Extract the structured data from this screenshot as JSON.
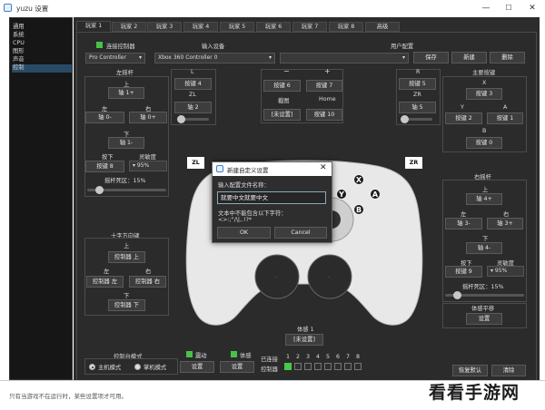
{
  "window": {
    "title": "yuzu 设置",
    "minimize": "—",
    "maximize": "☐",
    "close": "✕"
  },
  "sidebar": {
    "items": [
      "通用",
      "系统",
      "CPU",
      "图形",
      "声音",
      "控制"
    ],
    "selected": 5
  },
  "tabs": [
    "玩家 1",
    "玩家 2",
    "玩家 3",
    "玩家 4",
    "玩家 5",
    "玩家 6",
    "玩家 7",
    "玩家 8",
    "高级"
  ],
  "header": {
    "connect_label": "连接控制器",
    "controller_type": "Pro Controller",
    "input_device_label": "输入设备",
    "input_device": "Xbox 360 Controller 0",
    "user_profile_label": "用户配置",
    "save": "保存",
    "new": "新建",
    "delete": "删除"
  },
  "left_stick": {
    "title": "左摇杆",
    "up": "上",
    "up_btn": "轴 1+",
    "left": "左",
    "left_btn": "轴 0-",
    "right": "右",
    "right_btn": "轴 0+",
    "down": "下",
    "down_btn": "轴 1-",
    "press": "按下",
    "press_btn": "按键 8",
    "sensitivity": "灵敏度",
    "sensitivity_val": "95%",
    "deadzone": "摇杆死区：15%",
    "deadzone_fraction": 0.15
  },
  "dpad": {
    "title": "十字方向键",
    "up": "上",
    "up_btn": "控制器 上",
    "left": "左",
    "left_btn": "控制器 左",
    "right": "右",
    "right_btn": "控制器 右",
    "down": "下",
    "down_btn": "控制器 下"
  },
  "shoulders": {
    "L": "L",
    "L_btn": "按键 4",
    "ZL": "ZL",
    "ZL_btn": "轴 2",
    "minus": "−",
    "minus_btn": "按键 6",
    "plus": "+",
    "plus_btn": "按键 7",
    "capture": "截图",
    "capture_btn": "[未设置]",
    "home": "Home",
    "home_btn": "按键 10",
    "R": "R",
    "R_btn": "按键 5",
    "ZR": "ZR",
    "ZR_btn": "轴 5"
  },
  "face_buttons": {
    "title": "主要按键",
    "X": "X",
    "X_btn": "按键 3",
    "Y": "Y",
    "Y_btn": "按键 2",
    "A": "A",
    "A_btn": "按键 1",
    "B": "B",
    "B_btn": "按键 0"
  },
  "right_stick": {
    "title": "右摇杆",
    "up": "上",
    "up_btn": "轴 4+",
    "left": "左",
    "left_btn": "轴 3-",
    "right": "右",
    "right_btn": "轴 3+",
    "down": "下",
    "down_btn": "轴 4-",
    "press": "按下",
    "press_btn": "按键 9",
    "sensitivity": "灵敏度",
    "sensitivity_val": "95%",
    "deadzone": "摇杆死区：15%",
    "deadzone_fraction": 0.15
  },
  "motion": {
    "title": "体感平移",
    "btn": "设置"
  },
  "controller_graphic": {
    "ZL": "ZL",
    "ZR": "ZR",
    "X": "X",
    "Y": "Y",
    "A": "A",
    "B": "B"
  },
  "bottom": {
    "mode_label": "控制台模式",
    "docked": "主机模式",
    "handheld": "掌机模式",
    "vibration": "震动",
    "vibration_btn": "设置",
    "motion": "体感",
    "motion_btn": "设置",
    "motion1_label": "体感 1",
    "motion1_btn": "[未设置]",
    "connected_label": "已连接",
    "controller_label": "控制器",
    "slot_numbers": [
      "1",
      "2",
      "3",
      "4",
      "5",
      "6",
      "7",
      "8"
    ],
    "restore_defaults": "恢复默认",
    "clear": "清除"
  },
  "dialog": {
    "title": "新建自定义设置",
    "prompt": "输入配置文件名称：",
    "input_value": "就要中文就要中文",
    "hint": "文本中不能包含以下字符：",
    "hint_chars": "<>:;\"/\\|,.!?*",
    "ok": "OK",
    "cancel": "Cancel"
  },
  "status_bar": {
    "text": "只有当游戏不在运行时，某些设置项才可用。"
  },
  "watermark": "看看手游网",
  "colors": {
    "accent_green": "#47c247",
    "selection_blue": "#294a66",
    "panel": "#2b2b2b"
  }
}
